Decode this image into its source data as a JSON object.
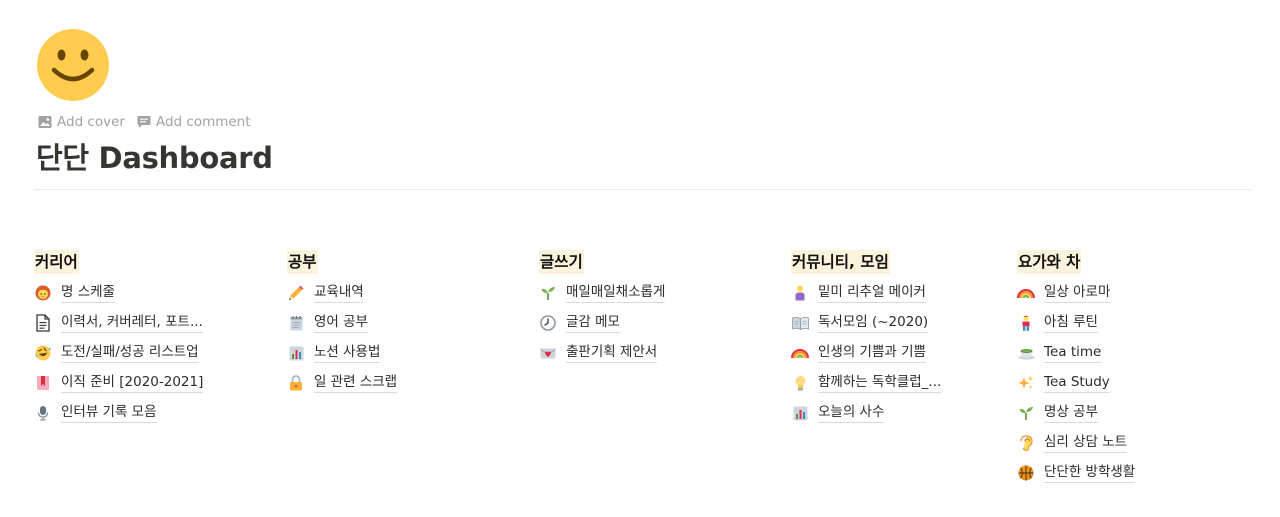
{
  "page": {
    "icon": "smiley-face-icon",
    "controls": [
      {
        "label": "Add cover",
        "icon": "image-icon"
      },
      {
        "label": "Add comment",
        "icon": "comment-icon"
      }
    ],
    "title": "단단 Dashboard"
  },
  "columns": [
    {
      "heading": "커리어",
      "items": [
        {
          "label": "명 스케줄",
          "icon": "woman-red-hair-icon"
        },
        {
          "label": "이력서, 커버레터, 포트...",
          "icon": "document-icon"
        },
        {
          "label": "도전/실패/성공 리스트업",
          "icon": "rolling-laugh-icon"
        },
        {
          "label": "이직 준비 [2020-2021]",
          "icon": "bookmark-icon"
        },
        {
          "label": "인터뷰 기록 모음",
          "icon": "microphone-icon"
        }
      ]
    },
    {
      "heading": "공부",
      "items": [
        {
          "label": "교육내역",
          "icon": "pencil-icon"
        },
        {
          "label": "영어 공부",
          "icon": "notepad-icon"
        },
        {
          "label": "노션 사용법",
          "icon": "bar-chart-icon"
        },
        {
          "label": "일 관련 스크랩",
          "icon": "lock-icon"
        }
      ]
    },
    {
      "heading": "글쓰기",
      "items": [
        {
          "label": "매일매일채소롭게",
          "icon": "seedling-icon"
        },
        {
          "label": "글감 메모",
          "icon": "clock-icon"
        },
        {
          "label": "출판기획 제안서",
          "icon": "heart-letter-icon"
        }
      ]
    },
    {
      "heading": "커뮤니티, 모임",
      "items": [
        {
          "label": "밑미 리추얼 메이커",
          "icon": "person-icon"
        },
        {
          "label": "독서모임 (~2020)",
          "icon": "open-book-icon"
        },
        {
          "label": "인생의 기쁨과 기쁨",
          "icon": "rainbow-icon"
        },
        {
          "label": "함께하는 독학클럽_...",
          "icon": "lightbulb-icon"
        },
        {
          "label": "오늘의 사수",
          "icon": "bar-chart-icon"
        }
      ]
    },
    {
      "heading": "요가와 차",
      "items": [
        {
          "label": "일상 아로마",
          "icon": "rainbow-icon"
        },
        {
          "label": "아침 루틴",
          "icon": "person-standing-icon"
        },
        {
          "label": "Tea time",
          "icon": "tea-cup-icon"
        },
        {
          "label": "Tea Study",
          "icon": "sparkles-icon"
        },
        {
          "label": "명상 공부",
          "icon": "seedling-icon"
        },
        {
          "label": "심리 상담 노트",
          "icon": "ear-icon"
        },
        {
          "label": "단단한 방학생활",
          "icon": "basketball-icon"
        }
      ]
    }
  ],
  "colors": {
    "heading_highlight": "#fbf3db",
    "text": "#37352f",
    "muted": "#a3a29e",
    "divider": "#e9e9e7"
  }
}
